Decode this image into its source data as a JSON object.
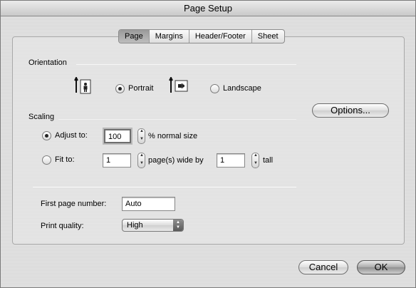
{
  "window": {
    "title": "Page Setup"
  },
  "tabs": [
    {
      "label": "Page",
      "selected": true
    },
    {
      "label": "Margins",
      "selected": false
    },
    {
      "label": "Header/Footer",
      "selected": false
    },
    {
      "label": "Sheet",
      "selected": false
    }
  ],
  "orientation": {
    "label": "Orientation",
    "portrait_label": "Portrait",
    "landscape_label": "Landscape",
    "selected": "Portrait",
    "portrait_icon": "portrait-page-icon",
    "landscape_icon": "landscape-page-icon"
  },
  "options_button": {
    "label": "Options..."
  },
  "scaling": {
    "label": "Scaling",
    "adjust_label": "Adjust to:",
    "adjust_value": "100",
    "adjust_suffix": "% normal size",
    "fit_label": "Fit to:",
    "fit_wide_value": "1",
    "fit_wide_suffix": "page(s) wide by",
    "fit_tall_value": "1",
    "fit_tall_suffix": "tall",
    "selected": "Adjust to:"
  },
  "first_page": {
    "label": "First page number:",
    "value": "Auto"
  },
  "print_quality": {
    "label": "Print quality:",
    "value": "High"
  },
  "buttons": {
    "cancel": "Cancel",
    "ok": "OK"
  }
}
